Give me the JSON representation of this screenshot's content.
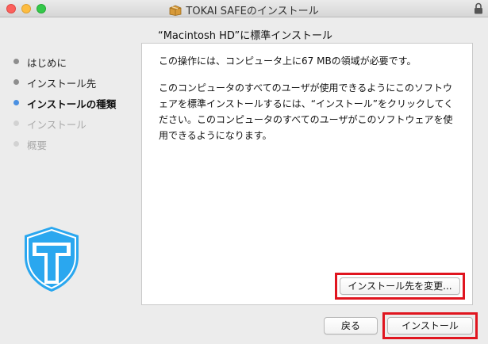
{
  "window": {
    "title": "TOKAI SAFEのインストール"
  },
  "icons": {
    "package": "package-icon",
    "lock": "lock-icon",
    "logo": "tokai-shield-logo"
  },
  "subheading": "“Macintosh HD”に標準インストール",
  "sidebar": {
    "items": [
      {
        "label": "はじめに",
        "state": "done"
      },
      {
        "label": "インストール先",
        "state": "done"
      },
      {
        "label": "インストールの種類",
        "state": "active"
      },
      {
        "label": "インストール",
        "state": "pending"
      },
      {
        "label": "概要",
        "state": "pending"
      }
    ]
  },
  "content": {
    "paragraph1": "この操作には、コンピュータ上に67 MBの領域が必要です。",
    "paragraph2": "このコンピュータのすべてのユーザが使用できるようにこのソフトウェアを標準インストールするには、“インストール”をクリックしてください。このコンピュータのすべてのユーザがこのソフトウェアを使用できるようになります。"
  },
  "buttons": {
    "change_location": "インストール先を変更...",
    "back": "戻る",
    "install": "インストール"
  },
  "colors": {
    "accent": "#4a90e2",
    "logo_blue": "#2aa7ef",
    "highlight": "#e0151f"
  }
}
